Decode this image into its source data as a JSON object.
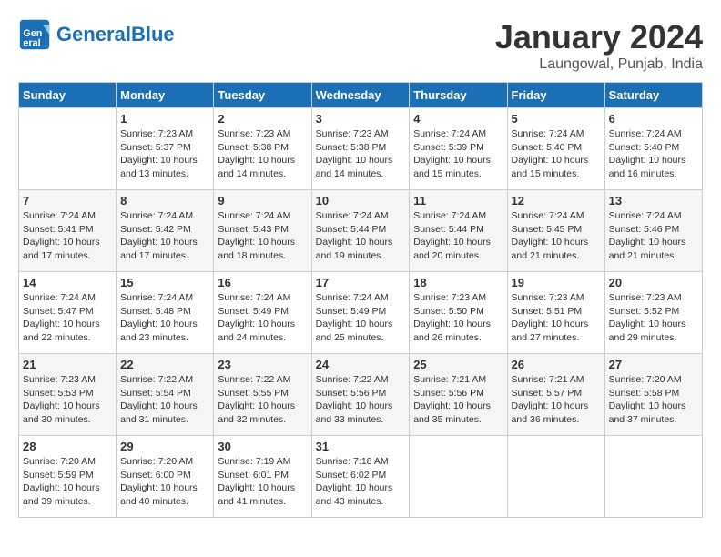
{
  "header": {
    "logo_general": "General",
    "logo_blue": "Blue",
    "title": "January 2024",
    "subtitle": "Laungowal, Punjab, India"
  },
  "weekdays": [
    "Sunday",
    "Monday",
    "Tuesday",
    "Wednesday",
    "Thursday",
    "Friday",
    "Saturday"
  ],
  "weeks": [
    [
      {
        "day": "",
        "info": ""
      },
      {
        "day": "1",
        "info": "Sunrise: 7:23 AM\nSunset: 5:37 PM\nDaylight: 10 hours\nand 13 minutes."
      },
      {
        "day": "2",
        "info": "Sunrise: 7:23 AM\nSunset: 5:38 PM\nDaylight: 10 hours\nand 14 minutes."
      },
      {
        "day": "3",
        "info": "Sunrise: 7:23 AM\nSunset: 5:38 PM\nDaylight: 10 hours\nand 14 minutes."
      },
      {
        "day": "4",
        "info": "Sunrise: 7:24 AM\nSunset: 5:39 PM\nDaylight: 10 hours\nand 15 minutes."
      },
      {
        "day": "5",
        "info": "Sunrise: 7:24 AM\nSunset: 5:40 PM\nDaylight: 10 hours\nand 15 minutes."
      },
      {
        "day": "6",
        "info": "Sunrise: 7:24 AM\nSunset: 5:40 PM\nDaylight: 10 hours\nand 16 minutes."
      }
    ],
    [
      {
        "day": "7",
        "info": "Sunrise: 7:24 AM\nSunset: 5:41 PM\nDaylight: 10 hours\nand 17 minutes."
      },
      {
        "day": "8",
        "info": "Sunrise: 7:24 AM\nSunset: 5:42 PM\nDaylight: 10 hours\nand 17 minutes."
      },
      {
        "day": "9",
        "info": "Sunrise: 7:24 AM\nSunset: 5:43 PM\nDaylight: 10 hours\nand 18 minutes."
      },
      {
        "day": "10",
        "info": "Sunrise: 7:24 AM\nSunset: 5:44 PM\nDaylight: 10 hours\nand 19 minutes."
      },
      {
        "day": "11",
        "info": "Sunrise: 7:24 AM\nSunset: 5:44 PM\nDaylight: 10 hours\nand 20 minutes."
      },
      {
        "day": "12",
        "info": "Sunrise: 7:24 AM\nSunset: 5:45 PM\nDaylight: 10 hours\nand 21 minutes."
      },
      {
        "day": "13",
        "info": "Sunrise: 7:24 AM\nSunset: 5:46 PM\nDaylight: 10 hours\nand 21 minutes."
      }
    ],
    [
      {
        "day": "14",
        "info": "Sunrise: 7:24 AM\nSunset: 5:47 PM\nDaylight: 10 hours\nand 22 minutes."
      },
      {
        "day": "15",
        "info": "Sunrise: 7:24 AM\nSunset: 5:48 PM\nDaylight: 10 hours\nand 23 minutes."
      },
      {
        "day": "16",
        "info": "Sunrise: 7:24 AM\nSunset: 5:49 PM\nDaylight: 10 hours\nand 24 minutes."
      },
      {
        "day": "17",
        "info": "Sunrise: 7:24 AM\nSunset: 5:49 PM\nDaylight: 10 hours\nand 25 minutes."
      },
      {
        "day": "18",
        "info": "Sunrise: 7:23 AM\nSunset: 5:50 PM\nDaylight: 10 hours\nand 26 minutes."
      },
      {
        "day": "19",
        "info": "Sunrise: 7:23 AM\nSunset: 5:51 PM\nDaylight: 10 hours\nand 27 minutes."
      },
      {
        "day": "20",
        "info": "Sunrise: 7:23 AM\nSunset: 5:52 PM\nDaylight: 10 hours\nand 29 minutes."
      }
    ],
    [
      {
        "day": "21",
        "info": "Sunrise: 7:23 AM\nSunset: 5:53 PM\nDaylight: 10 hours\nand 30 minutes."
      },
      {
        "day": "22",
        "info": "Sunrise: 7:22 AM\nSunset: 5:54 PM\nDaylight: 10 hours\nand 31 minutes."
      },
      {
        "day": "23",
        "info": "Sunrise: 7:22 AM\nSunset: 5:55 PM\nDaylight: 10 hours\nand 32 minutes."
      },
      {
        "day": "24",
        "info": "Sunrise: 7:22 AM\nSunset: 5:56 PM\nDaylight: 10 hours\nand 33 minutes."
      },
      {
        "day": "25",
        "info": "Sunrise: 7:21 AM\nSunset: 5:56 PM\nDaylight: 10 hours\nand 35 minutes."
      },
      {
        "day": "26",
        "info": "Sunrise: 7:21 AM\nSunset: 5:57 PM\nDaylight: 10 hours\nand 36 minutes."
      },
      {
        "day": "27",
        "info": "Sunrise: 7:20 AM\nSunset: 5:58 PM\nDaylight: 10 hours\nand 37 minutes."
      }
    ],
    [
      {
        "day": "28",
        "info": "Sunrise: 7:20 AM\nSunset: 5:59 PM\nDaylight: 10 hours\nand 39 minutes."
      },
      {
        "day": "29",
        "info": "Sunrise: 7:20 AM\nSunset: 6:00 PM\nDaylight: 10 hours\nand 40 minutes."
      },
      {
        "day": "30",
        "info": "Sunrise: 7:19 AM\nSunset: 6:01 PM\nDaylight: 10 hours\nand 41 minutes."
      },
      {
        "day": "31",
        "info": "Sunrise: 7:18 AM\nSunset: 6:02 PM\nDaylight: 10 hours\nand 43 minutes."
      },
      {
        "day": "",
        "info": ""
      },
      {
        "day": "",
        "info": ""
      },
      {
        "day": "",
        "info": ""
      }
    ]
  ]
}
